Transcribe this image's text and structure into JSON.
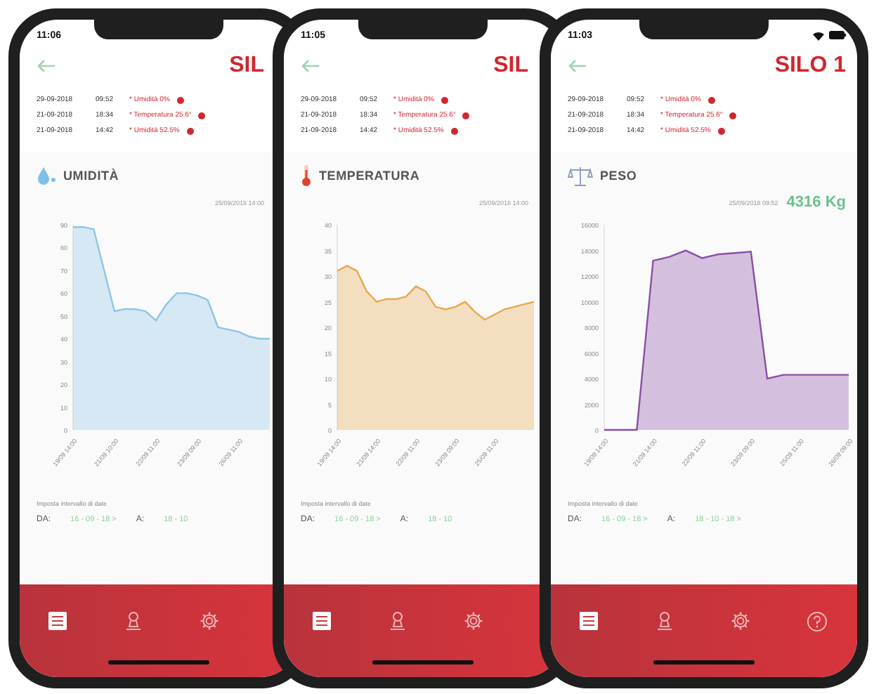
{
  "phones": [
    {
      "status": {
        "time": "11:06"
      },
      "title": "SIL",
      "alerts": [
        {
          "date": "29-09-2018",
          "time": "09:52",
          "text": "* Umidità 0%"
        },
        {
          "date": "21-09-2018",
          "time": "18:34",
          "text": "* Temperatura 25.6°"
        },
        {
          "date": "21-09-2018",
          "time": "14:42",
          "text": "* Umidità 52.5%"
        }
      ],
      "sensor": {
        "kind": "humidity",
        "name": "UMIDITÀ",
        "timestamp": "25/09/2018 14:00"
      },
      "chart_data": {
        "type": "area",
        "ylim": [
          0,
          90
        ],
        "categories": [
          "19/09 14:00",
          null,
          null,
          null,
          "21/09 10:00",
          null,
          null,
          null,
          "22/09 11:00",
          null,
          null,
          null,
          "23/09 09:00",
          null,
          null,
          null,
          "26/09 11:00",
          null,
          null,
          null
        ],
        "series": [
          {
            "color": "#8ec6e6",
            "values": [
              89,
              89,
              88,
              70,
              52,
              53,
              53,
              52,
              48,
              55,
              60,
              60,
              59,
              57,
              45,
              44,
              43,
              41,
              40,
              40
            ]
          }
        ],
        "yticks": [
          0,
          10,
          20,
          30,
          40,
          50,
          60,
          70,
          80,
          90
        ]
      },
      "date_range": {
        "label": "Imposta intervallo di date",
        "from_label": "DA:",
        "from": "16 - 09 - 18 >",
        "to_label": "A:",
        "to": "18 - 10"
      },
      "tabs": [
        {
          "selected": true
        },
        {
          "selected": false
        },
        {
          "selected": false
        }
      ]
    },
    {
      "status": {
        "time": "11:05"
      },
      "title": "SIL",
      "alerts": [
        {
          "date": "29-09-2018",
          "time": "09:52",
          "text": "* Umidità 0%"
        },
        {
          "date": "21-09-2018",
          "time": "18:34",
          "text": "* Temperatura 25.6°"
        },
        {
          "date": "21-09-2018",
          "time": "14:42",
          "text": "* Umidità 52.5%"
        }
      ],
      "sensor": {
        "kind": "temperature",
        "name": "TEMPERATURA",
        "timestamp": "25/09/2018 14:00"
      },
      "chart_data": {
        "type": "area",
        "ylim": [
          0,
          40
        ],
        "categories": [
          "19/09 14:00",
          null,
          null,
          null,
          "21/09 14:00",
          null,
          null,
          null,
          "22/09 11:00",
          null,
          null,
          null,
          "23/09 09:00",
          null,
          null,
          null,
          "25/09 11:00",
          null,
          null,
          null,
          null
        ],
        "series": [
          {
            "color": "#e8a94f",
            "values": [
              31,
              32,
              31,
              27,
              25,
              25.5,
              25.5,
              26,
              28,
              27,
              24,
              23.5,
              24,
              25,
              23,
              21.5,
              22.5,
              23.5,
              24,
              24.5,
              25
            ]
          }
        ],
        "yticks": [
          0,
          5,
          10,
          15,
          20,
          25,
          30,
          35,
          40
        ]
      },
      "date_range": {
        "label": "Imposta intervallo di date",
        "from_label": "DA:",
        "from": "16 - 09 - 18 >",
        "to_label": "A:",
        "to": "18 - 10"
      },
      "tabs": [
        {
          "selected": true
        },
        {
          "selected": false
        },
        {
          "selected": false
        }
      ]
    },
    {
      "status": {
        "time": "11:03",
        "signal_icons": true
      },
      "title": "SILO 1",
      "alerts": [
        {
          "date": "29-09-2018",
          "time": "09:52",
          "text": "* Umidità 0%"
        },
        {
          "date": "21-09-2018",
          "time": "18:34",
          "text": "* Temperatura 25.6°"
        },
        {
          "date": "21-09-2018",
          "time": "14:42",
          "text": "* Umidità 52.5%"
        }
      ],
      "sensor": {
        "kind": "weight",
        "name": "PESO",
        "timestamp": "25/09/2018 09:52",
        "reading": "4316 Kg"
      },
      "chart_data": {
        "type": "area",
        "ylim": [
          0,
          16000
        ],
        "categories": [
          "19/09 14:00",
          null,
          null,
          "21/09 14:00",
          null,
          null,
          "22/09 11:00",
          null,
          null,
          "23/09 09:00",
          null,
          null,
          "25/09 11:00",
          null,
          null,
          "26/09 09:00"
        ],
        "series": [
          {
            "color": "#8a4fa8",
            "values": [
              0,
              0,
              0,
              13200,
              13500,
              14000,
              13400,
              13700,
              13800,
              13900,
              4000,
              4300,
              4300,
              4300,
              4300,
              4300
            ]
          }
        ],
        "yticks": [
          0,
          2000,
          4000,
          6000,
          8000,
          10000,
          12000,
          14000,
          16000
        ]
      },
      "date_range": {
        "label": "Imposta intervallo di date",
        "from_label": "DA:",
        "from": "16 - 09 - 18 >",
        "to_label": "A:",
        "to": "18 - 10 - 18 >"
      },
      "tabs": [
        {
          "selected": true
        },
        {
          "selected": false
        },
        {
          "selected": false
        },
        {
          "selected": false
        }
      ]
    }
  ]
}
